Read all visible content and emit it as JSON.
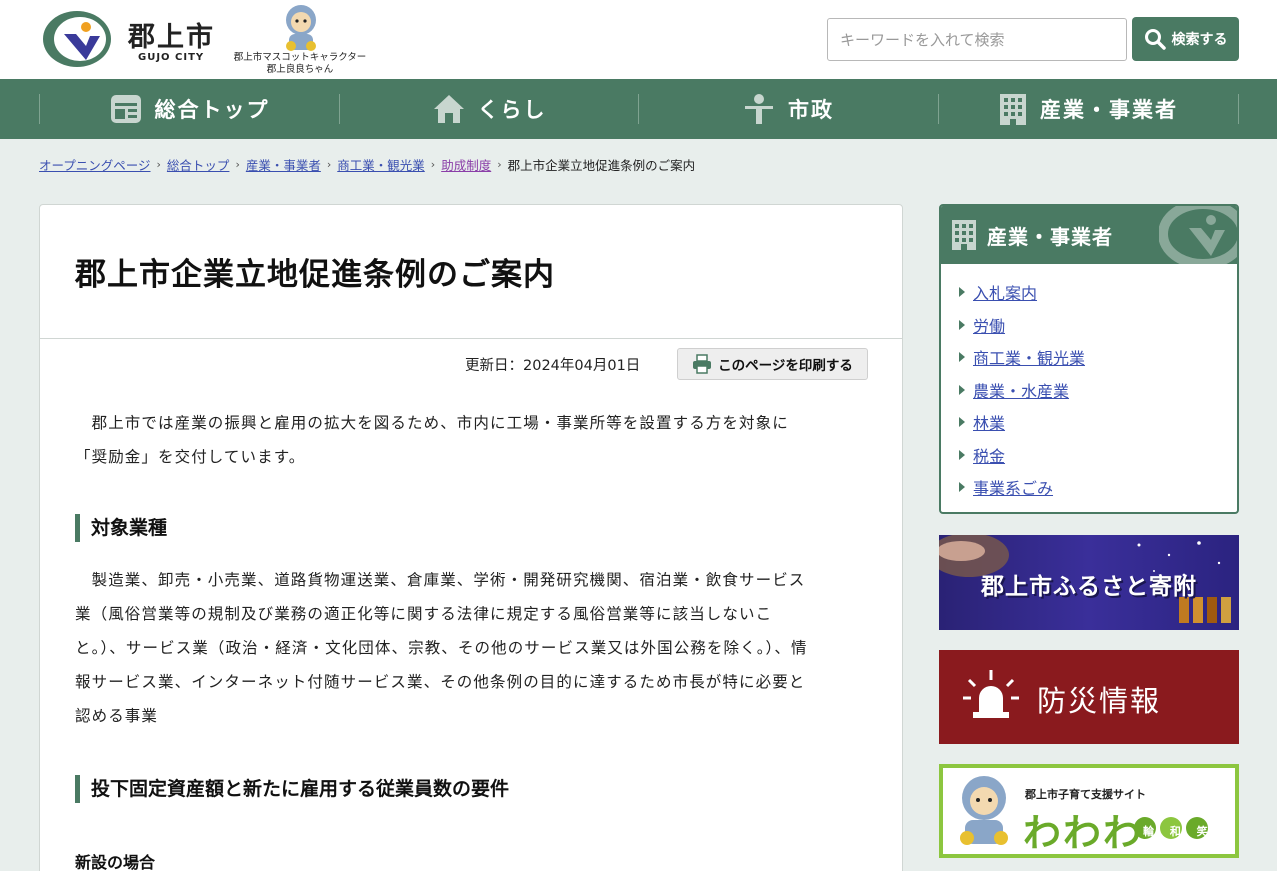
{
  "header": {
    "logo_text": "郡上市",
    "logo_sub": "GUJO CITY",
    "mascot_caption_1": "郡上市マスコットキャラクター",
    "mascot_caption_2": "郡上良良ちゃん",
    "search_placeholder": "キーワードを入れて検索",
    "search_button": "検索する"
  },
  "nav": {
    "items": [
      {
        "label": "総合トップ",
        "icon": "home-page-icon"
      },
      {
        "label": "くらし",
        "icon": "house-icon"
      },
      {
        "label": "市政",
        "icon": "person-icon"
      },
      {
        "label": "産業・事業者",
        "icon": "building-icon"
      }
    ]
  },
  "breadcrumb": {
    "items": [
      "オープニングページ",
      "総合トップ",
      "産業・事業者",
      "商工業・観光業",
      "助成制度"
    ],
    "current": "郡上市企業立地促進条例のご案内"
  },
  "main": {
    "title": "郡上市企業立地促進条例のご案内",
    "updated": "更新日：2024年04月01日",
    "print_button": "このページを印刷する",
    "intro_line1": "郡上市では産業の振興と雇用の拡大を図るため、市内に工場・事業所等を設置する方を対象に",
    "intro_line2": "「奨励金」を交付しています。",
    "section1_heading": "対象業種",
    "section1_lines": [
      "　製造業、卸売・小売業、道路貨物運送業、倉庫業、学術・開発研究機関、宿泊業・飲食サービス",
      "業（風俗営業等の規制及び業務の適正化等に関する法律に規定する風俗営業等に該当しないこ",
      "と。）、サービス業（政治・経済・文化団体、宗教、その他のサービス業又は外国公務を除く。）、情",
      "報サービス業、インターネット付随サービス業、その他条例の目的に達するため市長が特に必要と",
      "認める事業"
    ],
    "section2_heading": "投下固定資産額と新たに雇用する従業員数の要件",
    "section3_heading": "新設の場合"
  },
  "sidebar": {
    "heading": "産業・事業者",
    "items": [
      "入札案内",
      "労働",
      "商工業・観光業",
      "農業・水産業",
      "林業",
      "税金",
      "事業系ごみ"
    ]
  },
  "banners": {
    "furusato": "郡上市ふるさと寄附",
    "bousai": "防災情報",
    "wawawa_sub": "郡上市子育て支援サイト",
    "wawawa_big": "わわわ",
    "wawawa_small": "輪 和 笑"
  },
  "colors": {
    "brand_green": "#4a7a63",
    "link": "#3a4fb0",
    "visited": "#8a3ea8",
    "bousai_red": "#8a1a1e",
    "wawawa_green": "#8cc63f"
  }
}
